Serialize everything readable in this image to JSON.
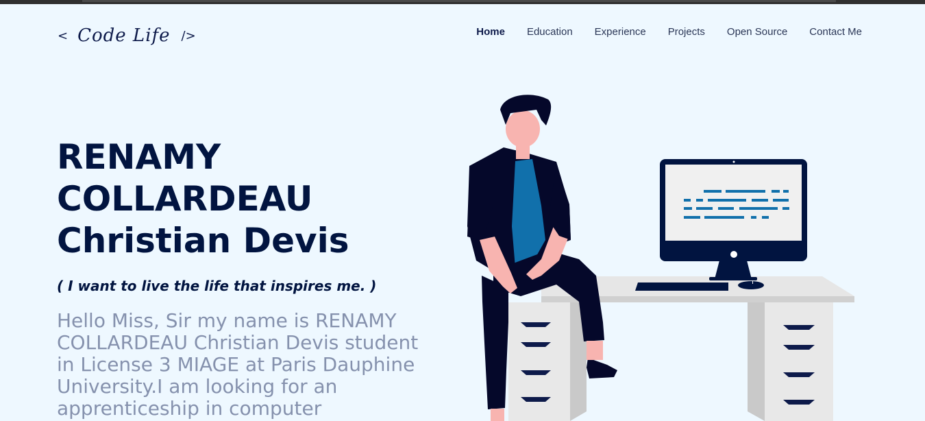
{
  "logo": {
    "open": "<",
    "script": "Code Life",
    "close": "/>"
  },
  "nav": {
    "items": [
      "Home",
      "Education",
      "Experience",
      "Projects",
      "Open Source",
      "Contact Me"
    ],
    "active": "Home"
  },
  "hero": {
    "name_lines": [
      "RENAMY",
      "COLLARDEAU",
      "Christian Devis"
    ],
    "quote": "( I want to live the life that inspires me. )",
    "intro": "Hello Miss, Sir my name is RENAMY COLLARDEAU Christian Devis student in License 3 MIAGE at Paris Dauphine University.I am looking for an apprenticeship in computer"
  },
  "colors": {
    "background": "#eef8ff",
    "primary_text": "#011440",
    "secondary_text": "#8591ad",
    "accent": "#1170ab"
  },
  "illustration": {
    "subject": "person-sitting-on-desk-with-computer",
    "icon": "developer-illustration"
  }
}
